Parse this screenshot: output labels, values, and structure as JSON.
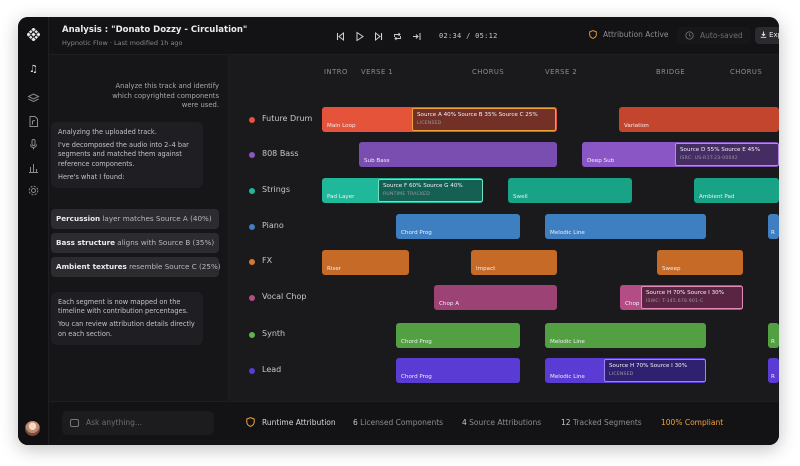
{
  "header": {
    "title": "Analysis : \"Donato Dozzy - Circulation\"",
    "subtitle": "Hypnotic Flow · Last modified 1h ago",
    "time": "02:34 / 05:12",
    "attribution_status": "Attribution Active",
    "autosave_status": "Auto-saved",
    "export_label": "Export"
  },
  "chat": {
    "user_message": "Analyze this track and identify which copyrighted components were used.",
    "reply1_line1": "Analyzing the uploaded track.",
    "reply1_line2": "I've decomposed the audio into 2–4 bar segments and matched them against reference components.",
    "reply1_line3": "Here's what I found:",
    "findings": [
      {
        "bold": "Percussion",
        "rest": " layer matches Source A (40%)"
      },
      {
        "bold": "Bass structure",
        "rest": " aligns with Source B (35%)"
      },
      {
        "bold": "Ambient textures",
        "rest": " resemble Source C (25%)"
      }
    ],
    "reply2_line1": "Each segment is now mapped on the timeline with contribution percentages.",
    "reply2_line2": "You can review attribution details directly on each section.",
    "input_placeholder": "Ask anything..."
  },
  "sections": [
    "INTRO",
    "VERSE 1",
    "CHORUS",
    "VERSE 2",
    "BRIDGE",
    "CHORUS"
  ],
  "tracks": [
    {
      "name": "Future Drum",
      "color": "#e5533a"
    },
    {
      "name": "808 Bass",
      "color": "#8a55c4"
    },
    {
      "name": "Strings",
      "color": "#1fb89a"
    },
    {
      "name": "Piano",
      "color": "#3d7fc1"
    },
    {
      "name": "FX",
      "color": "#d9782e"
    },
    {
      "name": "Vocal Chop",
      "color": "#b44c86"
    },
    {
      "name": "Synth",
      "color": "#5fb34b"
    },
    {
      "name": "Lead",
      "color": "#5a3bd3"
    }
  ],
  "clips": {
    "main_loop": "Main Loop",
    "variation": "Variation",
    "sub_bass": "Sub Bass",
    "deep_sub": "Deep Sub",
    "pad_layer": "Pad Layer",
    "swell": "Swell",
    "ambient_pad": "Ambient Pad",
    "chord_prog": "Chord Prog",
    "melodic_line": "Melodic Line",
    "piano_cut": "R",
    "riser": "Riser",
    "impact": "Impact",
    "sweep": "Sweep",
    "chop_a": "Chop A",
    "chop": "Chop",
    "synth_chord": "Chord Prog",
    "synth_melodic": "Melodic Line",
    "synth_cut": "R",
    "lead_chord": "Chord Prog",
    "lead_melodic": "Melodic Line",
    "lead_cut": "R"
  },
  "attributions": {
    "drum": {
      "l1": "Source A 40%   Source B 35%   Source C 25%",
      "l2": "LICENSED"
    },
    "bass": {
      "l1": "Source D 55%   Source E 45%",
      "l2": "ISRC: US-R1T-23-00042"
    },
    "strings": {
      "l1": "Source F 60%   Source G 40%",
      "l2": "RUNTIME TRACKED"
    },
    "vocal": {
      "l1": "Source H 70%   Source I 30%",
      "l2": "ISWC: T-345.678.901-C"
    },
    "lead": {
      "l1": "Source H 70%   Source I 30%",
      "l2": "LICENSED"
    }
  },
  "status": {
    "label": "Runtime Attribution",
    "licensed_num": "6",
    "licensed_text": "Licensed Components",
    "source_num": "4",
    "source_text": "Source Attributions",
    "segments_num": "12",
    "segments_text": "Tracked Segments",
    "compliant": "100% Compliant"
  },
  "colors": {
    "accent_gold": "#f0a23a",
    "background": "#131316"
  }
}
